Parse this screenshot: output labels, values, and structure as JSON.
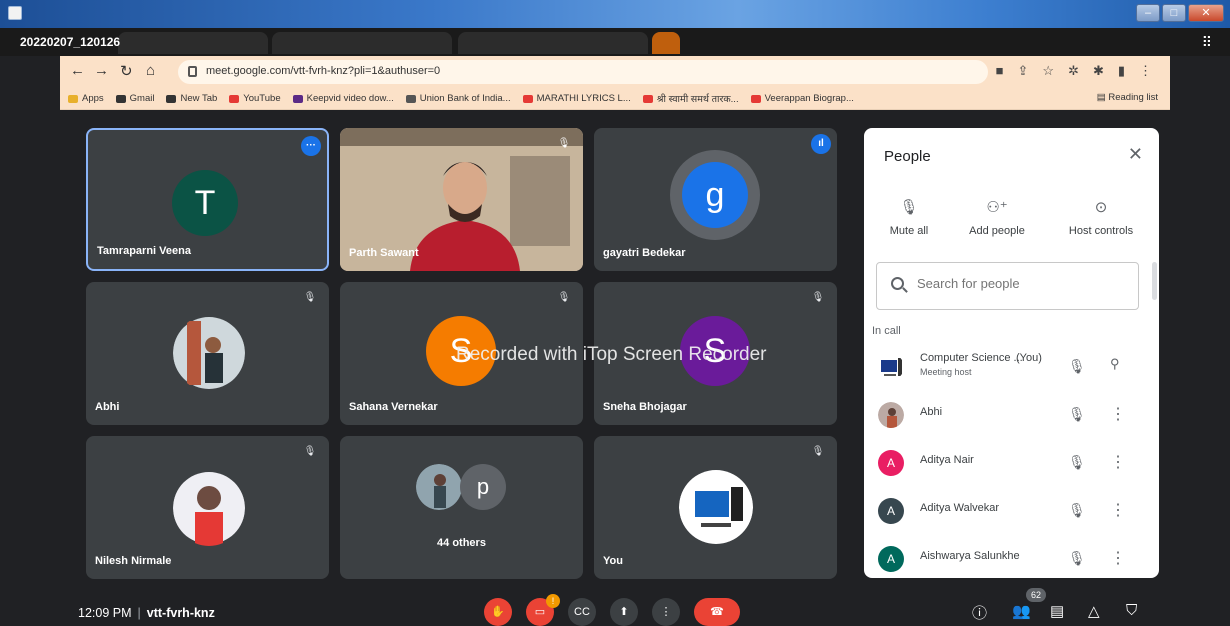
{
  "recording_label": "20220207_120126",
  "browser": {
    "url": "meet.google.com/vtt-fvrh-knz?pli=1&authuser=0",
    "bookmarks": [
      {
        "label": "Apps",
        "color": "#e8b02c"
      },
      {
        "label": "Gmail",
        "color": "#333333"
      },
      {
        "label": "New Tab",
        "color": "#333333"
      },
      {
        "label": "YouTube",
        "color": "#e53935"
      },
      {
        "label": "Keepvid video dow...",
        "color": "#5b2a86"
      },
      {
        "label": "Union Bank of India...",
        "color": "#555555"
      },
      {
        "label": "MARATHI LYRICS L...",
        "color": "#e53935"
      },
      {
        "label": "श्री स्वामी समर्थ तारक...",
        "color": "#e53935"
      },
      {
        "label": "Veerappan Biograp...",
        "color": "#e53935"
      }
    ],
    "reading_list": "Reading list"
  },
  "tiles": [
    {
      "name": "Tamraparni Veena",
      "initial": "T",
      "color": "#0b5345"
    },
    {
      "name": "Parth Sawant"
    },
    {
      "name": "gayatri Bedekar",
      "initial": "g",
      "color": "#1a73e8"
    },
    {
      "name": "Abhi"
    },
    {
      "name": "Sahana Vernekar",
      "initial": "S",
      "color": "#f57c00"
    },
    {
      "name": "Sneha Bhojagar",
      "initial": "S",
      "color": "#6a1b9a"
    },
    {
      "name": "Nilesh Nirmale"
    },
    {
      "name": "44 others",
      "initial": "p",
      "color": "#5f6368"
    },
    {
      "name": "You"
    }
  ],
  "watermark": "Recorded with iTop Screen Recorder",
  "people_panel": {
    "title": "People",
    "actions": [
      {
        "label": "Mute all",
        "icon": "mic-off-icon"
      },
      {
        "label": "Add people",
        "icon": "add-person-icon"
      },
      {
        "label": "Host controls",
        "icon": "toggle-icon"
      }
    ],
    "search_placeholder": "Search for people",
    "section": "In call",
    "people": [
      {
        "name": "Computer Science ...",
        "you": "(You)",
        "sub": "Meeting host",
        "color": "#1a3a8a"
      },
      {
        "name": "Abhi",
        "color": "#8d6e63"
      },
      {
        "name": "Aditya Nair",
        "initial": "A",
        "color": "#e91e63"
      },
      {
        "name": "Aditya Walvekar",
        "initial": "A",
        "color": "#37474f"
      },
      {
        "name": "Aishwarya Salunkhe",
        "initial": "A",
        "color": "#00695c"
      }
    ]
  },
  "bottom_bar": {
    "time": "12:09 PM",
    "meeting_code": "vtt-fvrh-knz",
    "participant_count": "62",
    "camera_badge": "!"
  }
}
